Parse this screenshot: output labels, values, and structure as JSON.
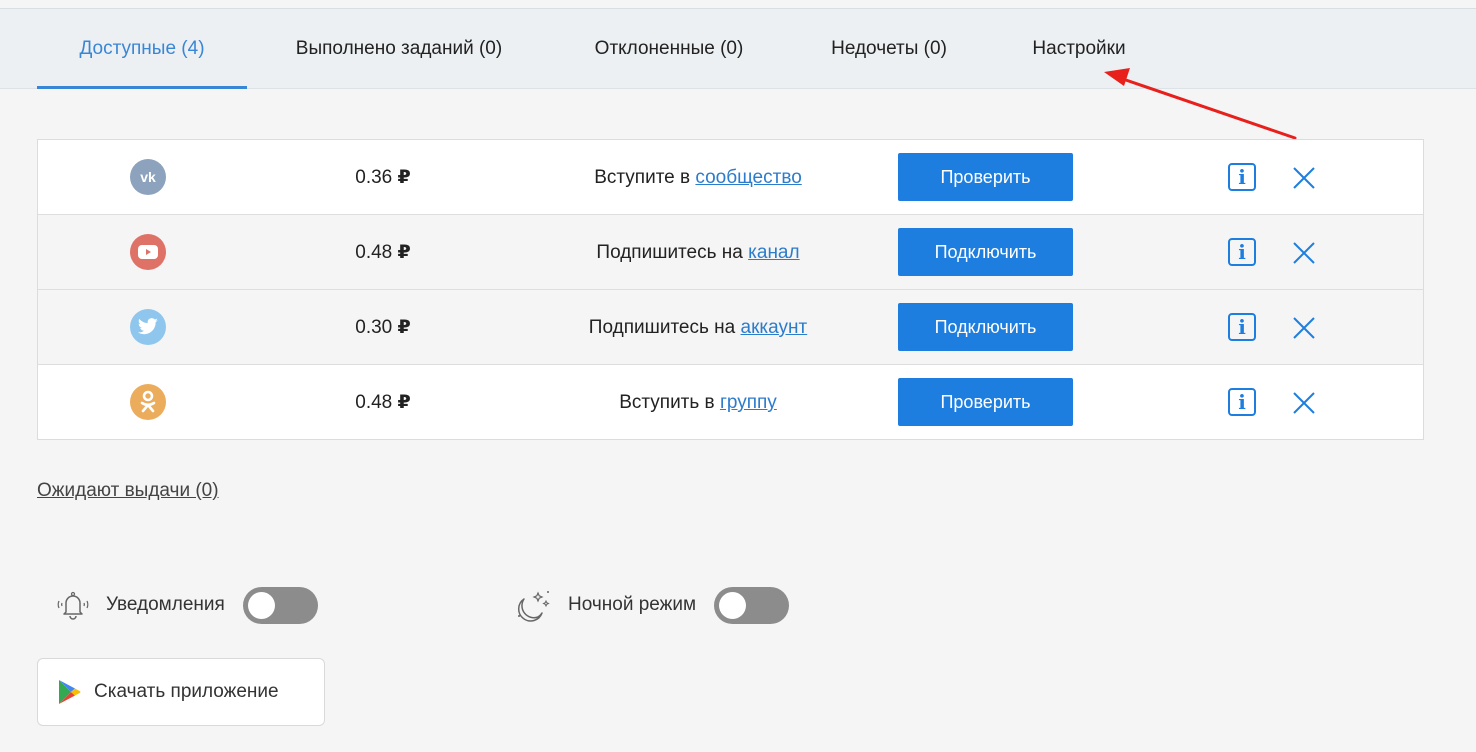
{
  "tabs": [
    {
      "label": "Доступные (4)",
      "active": true
    },
    {
      "label": "Выполнено заданий (0)",
      "active": false
    },
    {
      "label": "Отклоненные (0)",
      "active": false
    },
    {
      "label": "Недочеты (0)",
      "active": false
    },
    {
      "label": "Настройки",
      "active": false
    }
  ],
  "tasks": [
    {
      "network": "vk",
      "network_icon": "vk-icon",
      "color": "#8ca2bd",
      "price": "0.36",
      "currency": "₽",
      "text": "Вступите в",
      "link": "сообщество",
      "action": "Проверить"
    },
    {
      "network": "youtube",
      "network_icon": "youtube-icon",
      "color": "#df7267",
      "price": "0.48",
      "currency": "₽",
      "text": "Подпишитесь на",
      "link": "канал",
      "action": "Подключить"
    },
    {
      "network": "twitter",
      "network_icon": "twitter-icon",
      "color": "#8ec6ee",
      "price": "0.30",
      "currency": "₽",
      "text": "Подпишитесь на",
      "link": "аккаунт",
      "action": "Подключить"
    },
    {
      "network": "odnoklassniki",
      "network_icon": "odnoklassniki-icon",
      "color": "#ebac5c",
      "price": "0.48",
      "currency": "₽",
      "text": "Вступить в",
      "link": "группу",
      "action": "Проверить"
    }
  ],
  "info_glyph": "i",
  "pending_label": "Ожидают выдачи (0)",
  "settings": {
    "notifications_label": "Уведомления",
    "notifications_on": false,
    "night_mode_label": "Ночной режим",
    "night_mode_on": false
  },
  "download_label": "Скачать приложение",
  "colors": {
    "accent": "#1e7ee0",
    "tab_active": "#3a86d6",
    "toggle_off": "#8c8c8c",
    "annotation_arrow": "#e8201c"
  }
}
